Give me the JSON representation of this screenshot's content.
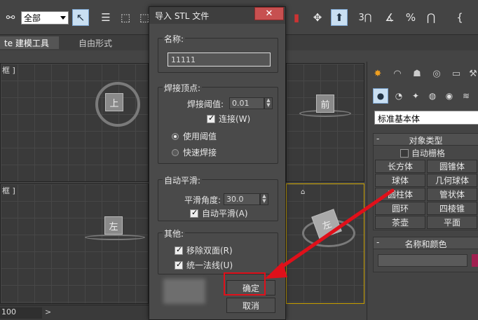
{
  "toolbar": {
    "selection_filter": "全部",
    "tool_icons": [
      "link-icon",
      "select-icon",
      "select-by-name-icon",
      "rect-select-icon",
      "snap-icon",
      "move-icon",
      "align-icon",
      "angle-snap-icon",
      "percent-snap-icon",
      "spinner-snap-icon",
      "edit-named-selection-icon"
    ],
    "counter_label": "3"
  },
  "ribbon": {
    "tabs": [
      "te 建模工具",
      "自由形式"
    ]
  },
  "viewports": {
    "top_left_label": "框 ]",
    "top_left_cube": "上",
    "top_right_cube": "前",
    "bottom_left_label": "框 ]",
    "bottom_left_cube": "左",
    "perspective_cube": "左"
  },
  "status": {
    "frame_value": "100",
    "arrow": ">"
  },
  "dialog": {
    "title": "导入 STL 文件",
    "close": "✕",
    "name_group": {
      "title": "名称:",
      "value": "11111"
    },
    "weld_group": {
      "title": "焊接顶点:",
      "threshold_label": "焊接阈值:",
      "threshold_value": "0.01",
      "connect_label": "连接(W)",
      "connect_checked": true,
      "radio_use_threshold": "使用阈值",
      "radio_quick_weld": "快速焊接",
      "selected_radio": "使用阈值"
    },
    "smooth_group": {
      "title": "自动平滑:",
      "angle_label": "平滑角度:",
      "angle_value": "30.0",
      "auto_smooth_label": "自动平滑(A)",
      "auto_smooth_checked": true
    },
    "other_group": {
      "title": "其他:",
      "remove_double_label": "移除双面(R)",
      "remove_double_checked": true,
      "unify_normals_label": "统一法线(U)",
      "unify_normals_checked": true
    },
    "ok_label": "确定",
    "cancel_label": "取消"
  },
  "command_panel": {
    "dropdown_value": "标准基本体",
    "object_type": {
      "title": "对象类型",
      "auto_grid": "自动栅格",
      "buttons": [
        "长方体",
        "圆锥体",
        "球体",
        "几何球体",
        "圆柱体",
        "管状体",
        "圆环",
        "四棱锥",
        "茶壶",
        "平面"
      ]
    },
    "name_color": {
      "title": "名称和颜色",
      "color": "#a02050"
    }
  },
  "annotation": {
    "highlight_color": "#e0101a"
  }
}
